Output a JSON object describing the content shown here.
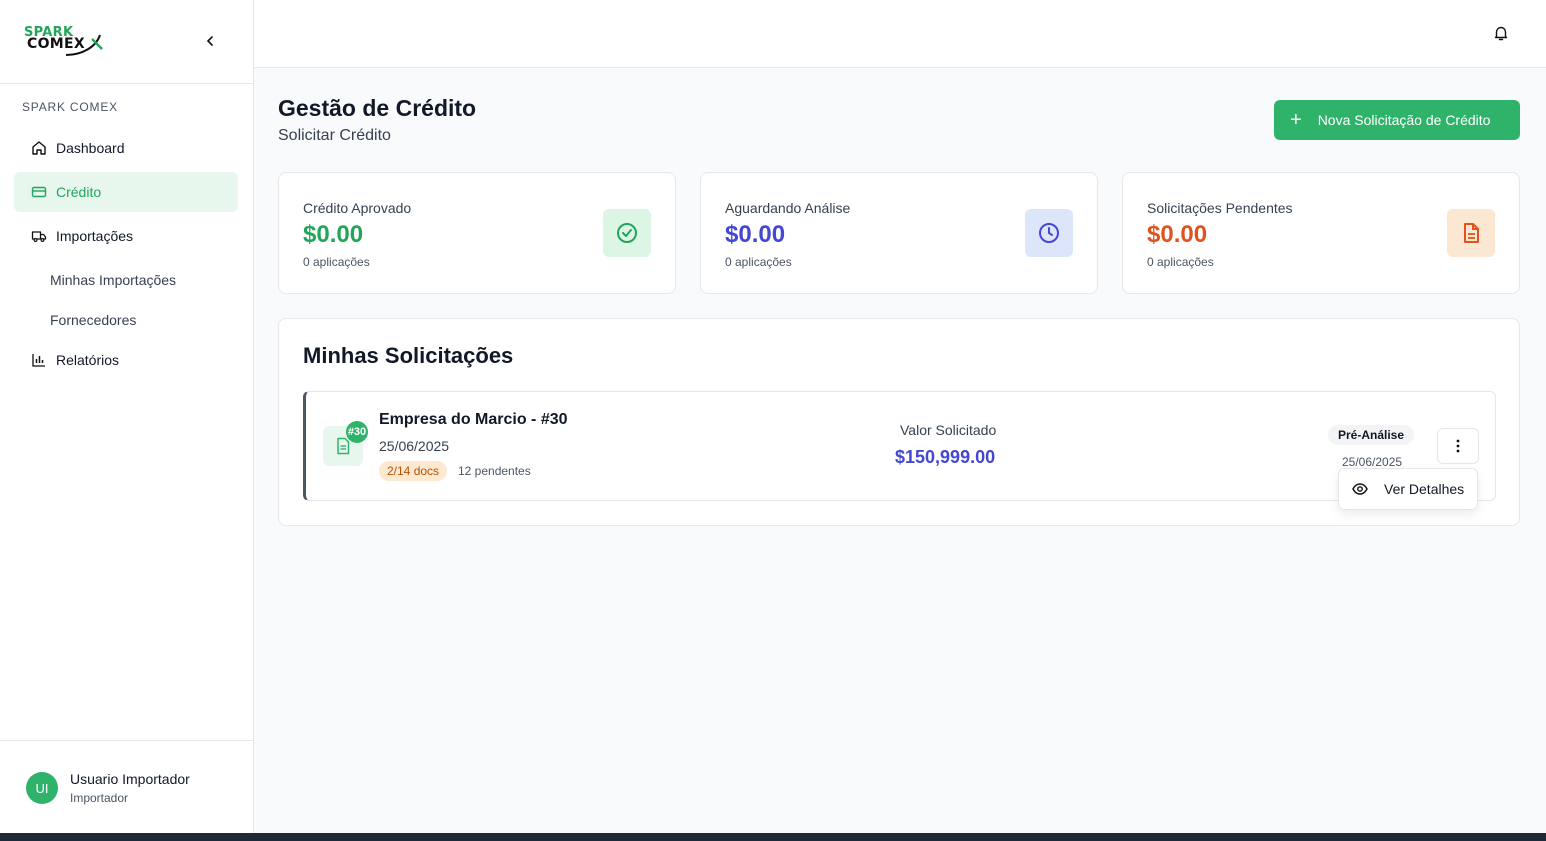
{
  "brand": {
    "logo_line1": "SPARK",
    "logo_line2": "COMEX",
    "green": "#2fb36a"
  },
  "sidebar": {
    "section": "SPARK COMEX",
    "items": [
      {
        "label": "Dashboard",
        "icon": "home-icon"
      },
      {
        "label": "Crédito",
        "icon": "credit-card-icon",
        "active": true
      },
      {
        "label": "Importações",
        "icon": "truck-icon"
      },
      {
        "label": "Minhas Importações"
      },
      {
        "label": "Fornecedores"
      },
      {
        "label": "Relatórios",
        "icon": "bar-chart-icon"
      }
    ],
    "user": {
      "initials": "UI",
      "name": "Usuario Importador",
      "role": "Importador"
    }
  },
  "header": {
    "title": "Gestão de Crédito",
    "subtitle": "Solicitar Crédito",
    "new_button": "Nova Solicitação de Crédito"
  },
  "stats": [
    {
      "label": "Crédito Aprovado",
      "value": "$0.00",
      "sub": "0 aplicações",
      "color": "#22a55b",
      "icon": "check-circle-icon"
    },
    {
      "label": "Aguardando Análise",
      "value": "$0.00",
      "sub": "0 aplicações",
      "color": "#4446d4",
      "icon": "clock-icon"
    },
    {
      "label": "Solicitações Pendentes",
      "value": "$0.00",
      "sub": "0 aplicações",
      "color": "#e0531f",
      "icon": "document-icon"
    }
  ],
  "requests": {
    "title": "Minhas Solicitações",
    "items": [
      {
        "badge": "#30",
        "name": "Empresa do Marcio - #30",
        "date": "25/06/2025",
        "docs": "2/14 docs",
        "pending": "12 pendentes",
        "value_label": "Valor Solicitado",
        "value": "$150,999.00",
        "status": "Pré-Análise",
        "status_date": "25/06/2025"
      }
    ]
  },
  "menu": {
    "view_details": "Ver Detalhes"
  }
}
